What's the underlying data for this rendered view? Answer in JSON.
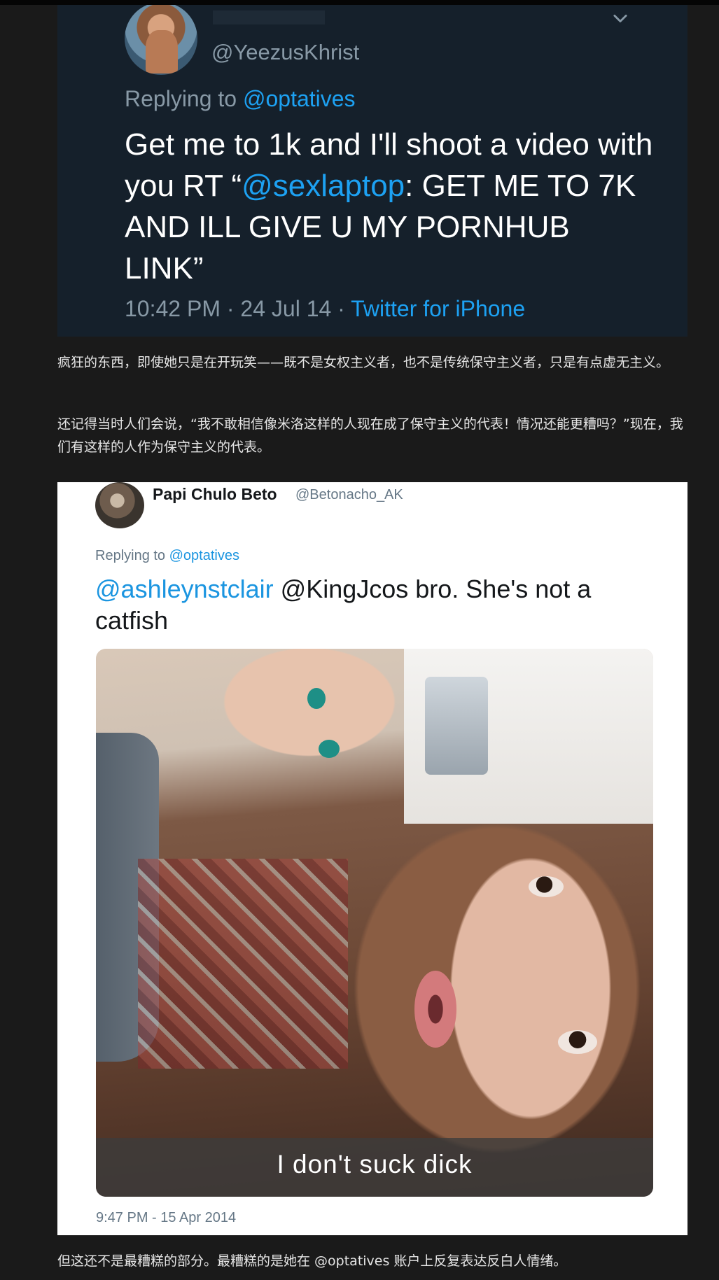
{
  "tweet1": {
    "handle": "@YeezusKhrist",
    "replying_prefix": "Replying to ",
    "replying_mention": "@optatives",
    "body_part1": "Get me to 1k and I'll shoot a video with you RT “",
    "body_mention": "@sexlaptop",
    "body_part2": ": GET ME TO 7K AND ILL GIVE U MY PORNHUB LINK”",
    "timestamp": "10:42 PM · 24 Jul 14 · ",
    "source": "Twitter for iPhone"
  },
  "paragraphs": {
    "p1": "疯狂的东西，即使她只是在开玩笑——既不是女权主义者，也不是传统保守主义者，只是有点虚无主义。",
    "p2": "还记得当时人们会说，“我不敢相信像米洛这样的人现在成了保守主义的代表！情况还能更糟吗？”现在，我们有这样的人作为保守主义的代表。",
    "p3": "但这还不是最糟糕的部分。最糟糕的是她在 @optatives 账户上反复表达反白人情绪。"
  },
  "tweet2": {
    "name": "Papi Chulo Beto",
    "handle": "@Betonacho_AK",
    "replying_prefix": "Replying to ",
    "replying_mention": "@optatives",
    "body_mention": "@ashleynstclair",
    "body_rest": " @KingJcos bro. She's not a catfish",
    "media_caption": "I don't suck dick",
    "timestamp": "9:47 PM - 15 Apr 2014"
  },
  "colors": {
    "page_bg": "#1a1a1a",
    "dark_tweet_bg": "#15202b",
    "link_blue": "#1da1f2",
    "muted_text": "#8899a6"
  },
  "icons": {
    "tweet1_menu": "chevron-down-icon"
  }
}
